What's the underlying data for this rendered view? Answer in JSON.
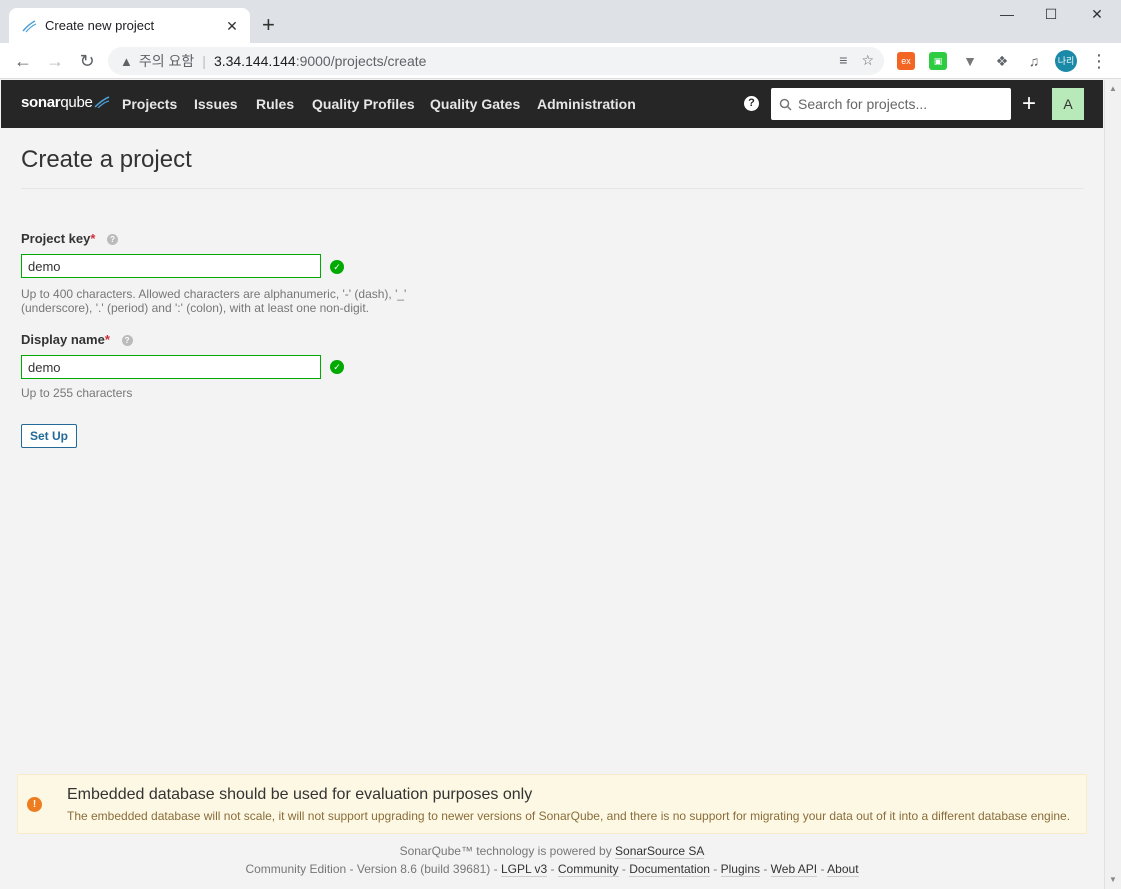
{
  "browser": {
    "tab_title": "Create new project",
    "close_glyph": "✕",
    "newtab_glyph": "+",
    "omnibox": {
      "warning_text": "주의 요함",
      "separator": "|",
      "host": "3.34.144.144",
      "path": ":9000/projects/create"
    },
    "profile_initials": "나리"
  },
  "nav": {
    "logo_sonar": "sonar",
    "logo_qube": "qube",
    "links": [
      "Projects",
      "Issues",
      "Rules",
      "Quality Profiles",
      "Quality Gates",
      "Administration"
    ],
    "search_placeholder": "Search for projects...",
    "avatar_letter": "A"
  },
  "page": {
    "title": "Create a project",
    "project_key": {
      "label": "Project key",
      "required_mark": "*",
      "value": "demo",
      "hint": "Up to 400 characters. Allowed characters are alphanumeric, '-' (dash), '_' (underscore), '.' (period) and ':' (colon), with at least one non-digit."
    },
    "display_name": {
      "label": "Display name",
      "required_mark": "*",
      "value": "demo",
      "hint": "Up to 255 characters"
    },
    "setup_button": "Set Up"
  },
  "warning": {
    "title": "Embedded database should be used for evaluation purposes only",
    "text": "The embedded database will not scale, it will not support upgrading to newer versions of SonarQube, and there is no support for migrating your data out of it into a different database engine."
  },
  "footer": {
    "powered_prefix": "SonarQube™ technology is powered by ",
    "powered_link": "SonarSource SA",
    "edition": "Community Edition",
    "version": "Version 8.6 (build 39681)",
    "links": [
      "LGPL v3",
      "Community",
      "Documentation",
      "Plugins",
      "Web API",
      "About"
    ]
  }
}
